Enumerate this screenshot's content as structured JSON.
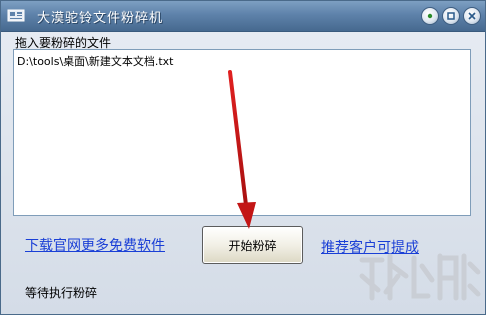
{
  "window": {
    "title": "大漠驼铃文件粉碎机",
    "icon": "app-icon"
  },
  "drop_area": {
    "label": "拖入要粉碎的文件",
    "files": [
      "D:\\tools\\桌面\\新建文本文档.txt"
    ]
  },
  "footer": {
    "left_link": "下载官网更多免费软件",
    "start_button": "开始粉碎",
    "right_link": "推荐客户可提成",
    "status": "等待执行粉碎"
  },
  "colors": {
    "link": "#1a3fd6",
    "annotation_arrow": "#cc1a1a"
  }
}
